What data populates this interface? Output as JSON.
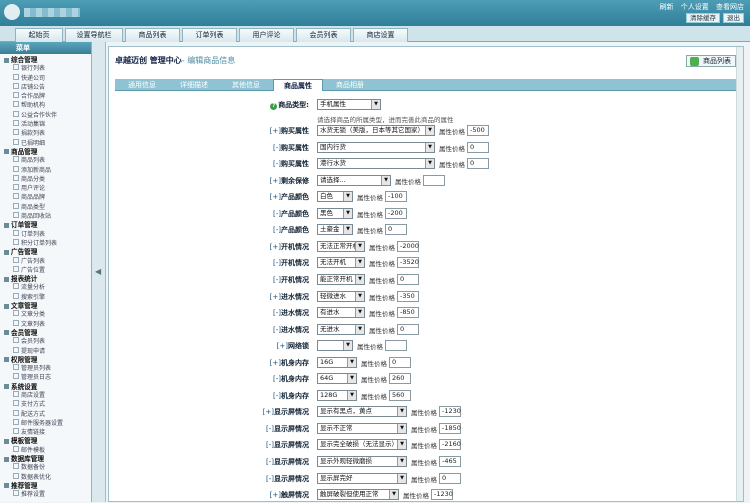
{
  "top": {
    "links": [
      "刷新",
      "个人设置",
      "查看网店"
    ],
    "clear_cache": "清除缓存",
    "logout": "退出"
  },
  "nav": [
    "起始页",
    "设置导航栏",
    "商品列表",
    "订单列表",
    "用户评论",
    "会员列表",
    "商店设置"
  ],
  "sidebar": {
    "title": "菜单",
    "groups": [
      {
        "name": "综合管理",
        "items": [
          "银行列表",
          "快递公司",
          "店铺公告",
          "合作品牌",
          "帮助机构",
          "公益合作伙伴",
          "活动集锦",
          "捐款列表",
          "已捐明细"
        ]
      },
      {
        "name": "商品管理",
        "items": [
          "商品列表",
          "添加新商品",
          "商品分类",
          "用户评论",
          "商品品牌",
          "商品类型",
          "商品回收站"
        ]
      },
      {
        "name": "订单管理",
        "items": [
          "订单列表",
          "积分订单列表"
        ]
      },
      {
        "name": "广告管理",
        "items": [
          "广告列表",
          "广告位置"
        ]
      },
      {
        "name": "报表统计",
        "items": [
          "流量分析",
          "搜索引擎"
        ]
      },
      {
        "name": "文章管理",
        "items": [
          "文章分类",
          "文章列表"
        ]
      },
      {
        "name": "会员管理",
        "items": [
          "会员列表",
          "提现申请"
        ]
      },
      {
        "name": "权限管理",
        "items": [
          "管理员列表",
          "管理员日志"
        ]
      },
      {
        "name": "系统设置",
        "items": [
          "商店设置",
          "支付方式",
          "配送方式",
          "邮件服务器设置",
          "友情链接"
        ]
      },
      {
        "name": "模板管理",
        "items": [
          "邮件模板"
        ]
      },
      {
        "name": "数据库管理",
        "items": [
          "数据备份",
          "数据表优化"
        ]
      },
      {
        "name": "推荐管理",
        "items": [
          "推荐设置"
        ]
      }
    ]
  },
  "main": {
    "title": "卓越迈创 管理中心",
    "subtitle": "- 编辑商品信息",
    "list_button": "商品列表",
    "tabs": [
      "通用信息",
      "详细描述",
      "其他信息",
      "商品属性",
      "商品相册"
    ],
    "active_tab": 3,
    "type_label": "商品类型:",
    "type_value": "手机属性",
    "type_hint": "请选择商品的所属类型，进而完善此商品的属性",
    "price_label": "属性价格",
    "rows": [
      {
        "pm": "[+]",
        "name": "购买属性",
        "value": "水货无锁（美版，日本等其它国家）",
        "price": "-500"
      },
      {
        "pm": "[-]",
        "name": "购买属性",
        "value": "国内行货",
        "price": "0"
      },
      {
        "pm": "[-]",
        "name": "购买属性",
        "value": "港行水货",
        "price": "0"
      },
      {
        "pm": "[+]",
        "name": "剩余保修",
        "value": "请选择...",
        "price": ""
      },
      {
        "pm": "[+]",
        "name": "产品颜色",
        "value": "白色",
        "price": "-100"
      },
      {
        "pm": "[-]",
        "name": "产品颜色",
        "value": "黑色",
        "price": "-200"
      },
      {
        "pm": "[-]",
        "name": "产品颜色",
        "value": "土豪金",
        "price": "0"
      },
      {
        "pm": "[+]",
        "name": "开机情况",
        "value": "无法正常开机",
        "price": "-2000"
      },
      {
        "pm": "[-]",
        "name": "开机情况",
        "value": "无法开机",
        "price": "-3520"
      },
      {
        "pm": "[-]",
        "name": "开机情况",
        "value": "能正常开机",
        "price": "0"
      },
      {
        "pm": "[+]",
        "name": "进水情况",
        "value": "轻微进水",
        "price": "-350"
      },
      {
        "pm": "[-]",
        "name": "进水情况",
        "value": "有进水",
        "price": "-850"
      },
      {
        "pm": "[-]",
        "name": "进水情况",
        "value": "无进水",
        "price": "0"
      },
      {
        "pm": "[+]",
        "name": "网络锁",
        "value": "",
        "price": ""
      },
      {
        "pm": "[+]",
        "name": "机身内存",
        "value": "16G",
        "price": "0"
      },
      {
        "pm": "[-]",
        "name": "机身内存",
        "value": "64G",
        "price": "260"
      },
      {
        "pm": "[-]",
        "name": "机身内存",
        "value": "128G",
        "price": "560"
      },
      {
        "pm": "[+]",
        "name": "显示屏情况",
        "value": "显示有黑点，黄点",
        "price": "-1230"
      },
      {
        "pm": "[-]",
        "name": "显示屏情况",
        "value": "显示不正常",
        "price": "-1850"
      },
      {
        "pm": "[-]",
        "name": "显示屏情况",
        "value": "显示完全破损（无法显示）",
        "price": "-2160"
      },
      {
        "pm": "[-]",
        "name": "显示屏情况",
        "value": "显示外观轻微磨损",
        "price": "-465"
      },
      {
        "pm": "[-]",
        "name": "显示屏情况",
        "value": "显示屏完好",
        "price": "0"
      },
      {
        "pm": "[+]",
        "name": "触屏情况",
        "value": "触屏破裂但使用正常",
        "price": "-1230"
      }
    ]
  }
}
